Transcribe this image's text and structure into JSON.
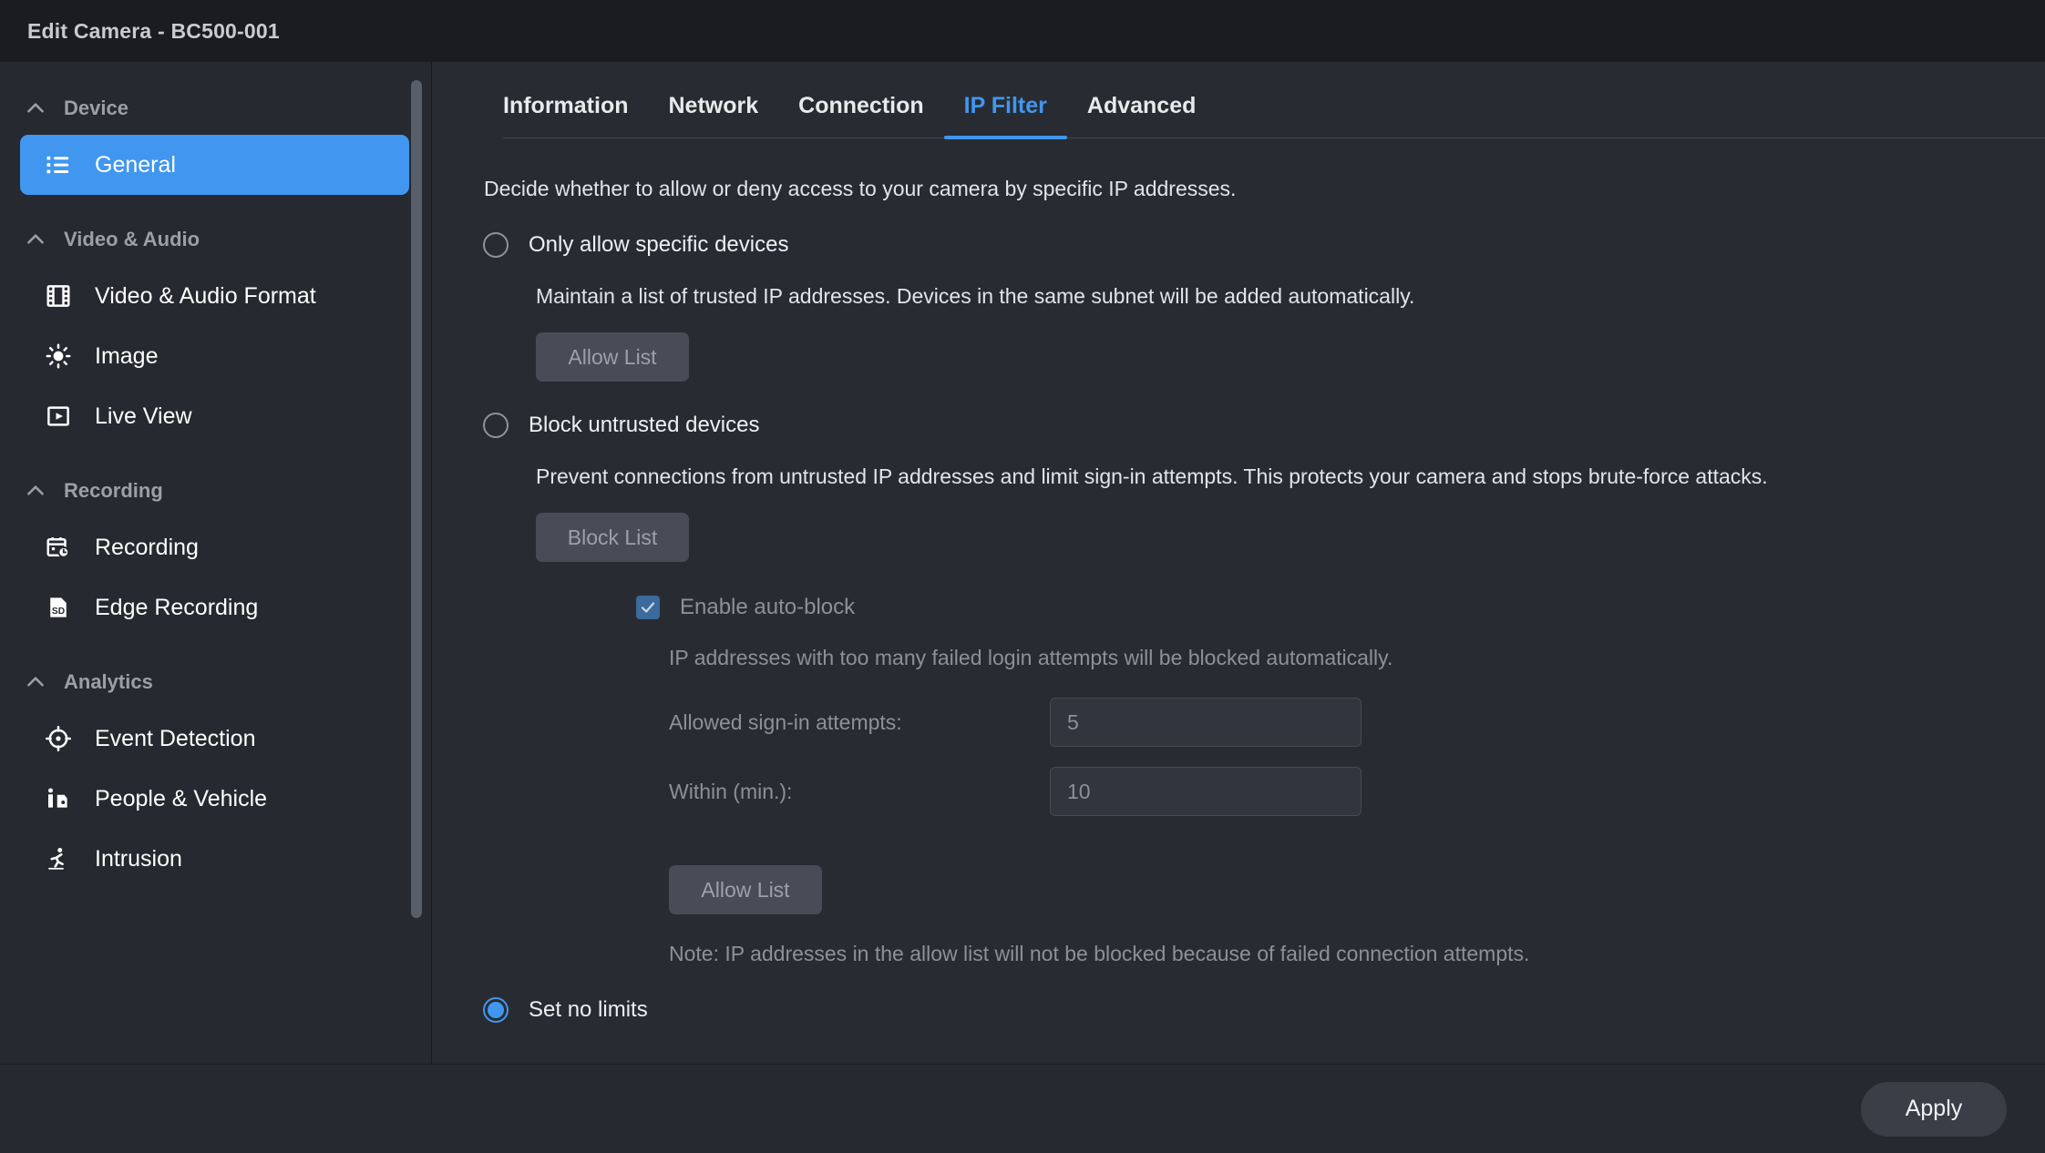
{
  "window": {
    "title": "Edit Camera - BC500-001"
  },
  "colors": {
    "accent": "#4196f0",
    "titlebar_bg": "#1a1c20",
    "sidebar_bg": "#26292f",
    "content_bg": "#282c32",
    "disabled_text": "#8b9199",
    "button_bg": "#474c56"
  },
  "sidebar": {
    "groups": [
      {
        "label": "Device",
        "icon": "chevron-up-icon",
        "items": [
          {
            "label": "General",
            "icon": "list-icon",
            "active": true
          }
        ]
      },
      {
        "label": "Video & Audio",
        "icon": "chevron-up-icon",
        "items": [
          {
            "label": "Video & Audio Format",
            "icon": "film-icon",
            "active": false
          },
          {
            "label": "Image",
            "icon": "brightness-icon",
            "active": false
          },
          {
            "label": "Live View",
            "icon": "play-box-icon",
            "active": false
          }
        ]
      },
      {
        "label": "Recording",
        "icon": "chevron-up-icon",
        "items": [
          {
            "label": "Recording",
            "icon": "calendar-clock-icon",
            "active": false
          },
          {
            "label": "Edge Recording",
            "icon": "sd-card-icon",
            "active": false
          }
        ]
      },
      {
        "label": "Analytics",
        "icon": "chevron-up-icon",
        "items": [
          {
            "label": "Event Detection",
            "icon": "crosshair-icon",
            "active": false
          },
          {
            "label": "People & Vehicle",
            "icon": "person-vehicle-icon",
            "active": false
          },
          {
            "label": "Intrusion",
            "icon": "running-person-icon",
            "active": false
          }
        ]
      }
    ]
  },
  "tabs": [
    {
      "label": "Information",
      "active": false
    },
    {
      "label": "Network",
      "active": false
    },
    {
      "label": "Connection",
      "active": false
    },
    {
      "label": "IP Filter",
      "active": true
    },
    {
      "label": "Advanced",
      "active": false
    }
  ],
  "ip_filter": {
    "intro": "Decide whether to allow or deny access to your camera by specific IP addresses.",
    "option_allow": {
      "label": "Only allow specific devices",
      "selected": false,
      "description": "Maintain a list of trusted IP addresses. Devices in the same subnet will be added automatically.",
      "button_label": "Allow List"
    },
    "option_block": {
      "label": "Block untrusted devices",
      "selected": false,
      "description": "Prevent connections from untrusted IP addresses and limit sign-in attempts. This protects your camera and stops brute-force attacks.",
      "button_label": "Block List",
      "auto_block": {
        "label": "Enable auto-block",
        "checked": true,
        "hint": "IP addresses with too many failed login attempts will be blocked automatically.",
        "fields": [
          {
            "label": "Allowed sign-in attempts:",
            "value": "5"
          },
          {
            "label": "Within (min.):",
            "value": "10"
          }
        ],
        "button_label": "Allow List",
        "note": "Note: IP addresses in the allow list will not be blocked because of failed connection attempts."
      }
    },
    "option_none": {
      "label": "Set no limits",
      "selected": true
    }
  },
  "footer": {
    "apply_label": "Apply"
  }
}
